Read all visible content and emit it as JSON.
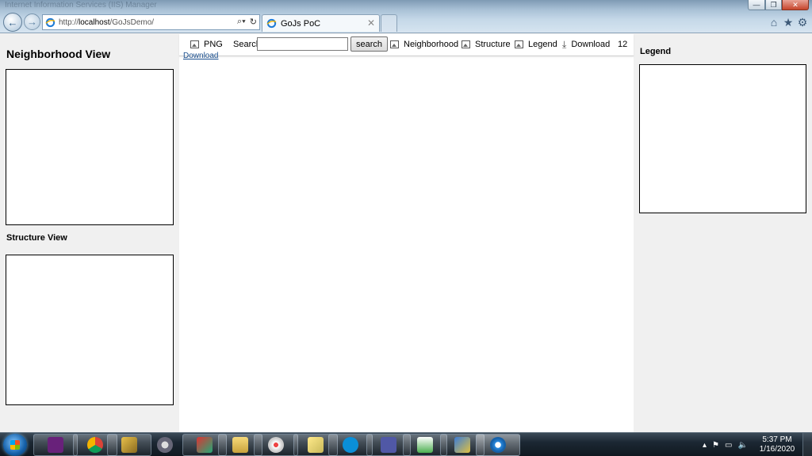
{
  "browser": {
    "faded_title": "Internet Information Services (IIS) Manager",
    "address": {
      "scheme": "http://",
      "host": "localhost",
      "path": "/GoJsDemo/"
    },
    "address_tools": [
      "⌕▾",
      "↻"
    ],
    "tab": {
      "title": "GoJs PoC",
      "close": "✕"
    },
    "window_controls": {
      "minimize": "—",
      "maximize": "❐",
      "close": "✕"
    },
    "toolbar_icons": [
      "home-icon",
      "star-icon",
      "gear-icon"
    ]
  },
  "left": {
    "neighborhood_title": "Neighborhood View",
    "structure_title": "Structure View"
  },
  "toolbar": {
    "png_label": "PNG",
    "search_label": "Search:",
    "search_value": "",
    "search_button": "search",
    "neighborhood_label": "Neighborhood",
    "structure_label": "Structure",
    "legend_label": "Legend",
    "download_label": "Download",
    "count": "12",
    "download_link": "Download"
  },
  "right": {
    "legend_title": "Legend"
  },
  "taskbar": {
    "apps": [
      "visual-studio",
      "chrome",
      "tools",
      "settings",
      "outlook",
      "file-explorer",
      "paint",
      "sticky-notes",
      "skype",
      "teams",
      "project",
      "network",
      "internet-explorer"
    ],
    "time": "5:37 PM",
    "date": "1/16/2020"
  }
}
